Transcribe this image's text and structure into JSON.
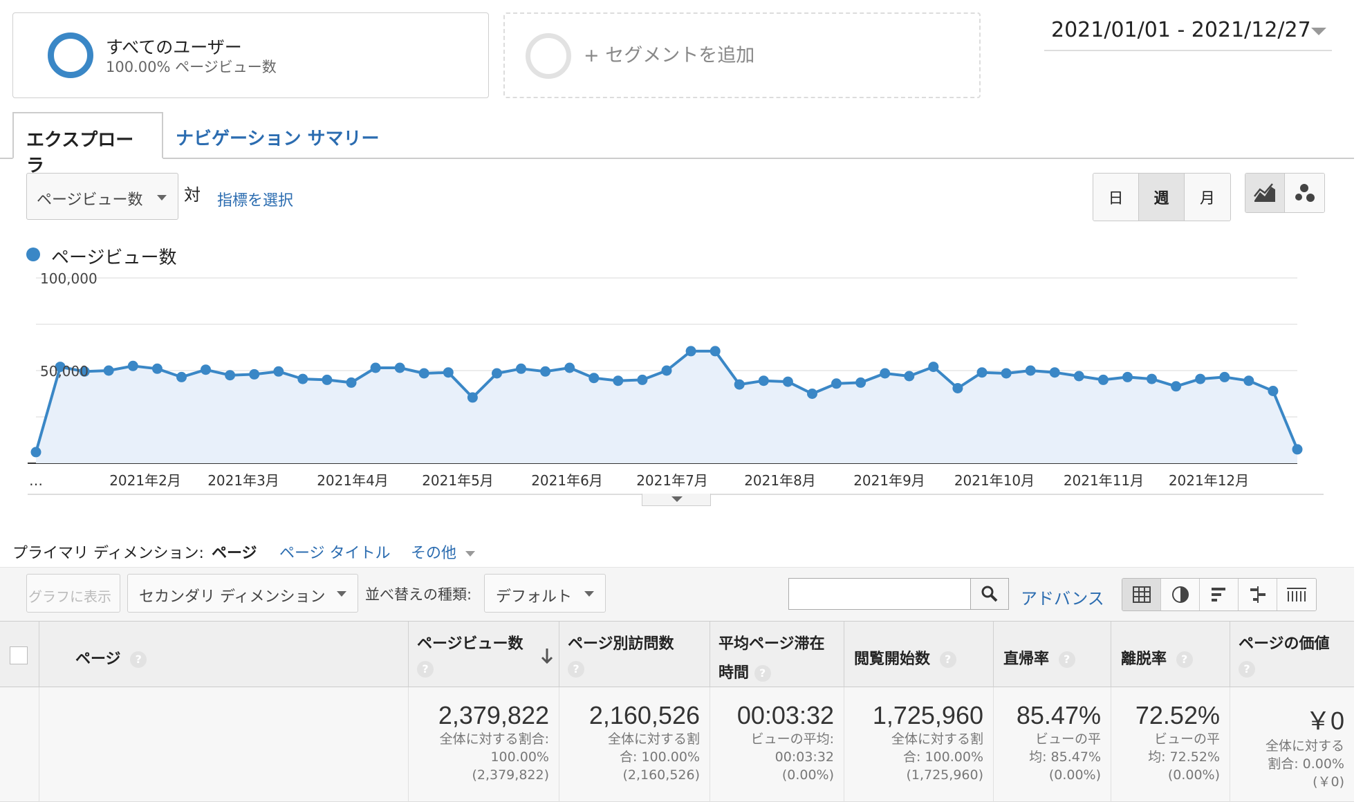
{
  "segments": {
    "active": {
      "name": "すべてのユーザー",
      "sub": "100.00% ページビュー数"
    },
    "add_label": "+ セグメントを追加"
  },
  "date_range": "2021/01/01 - 2021/12/27",
  "tabs": {
    "explorer": "エクスプローラ",
    "nav_summary": "ナビゲーション サマリー"
  },
  "metric": {
    "selected": "ページビュー数",
    "vs": "対",
    "pick": "指標を選択"
  },
  "interval": {
    "day": "日",
    "week": "週",
    "month": "月",
    "selected": "週"
  },
  "chart_icons": [
    "line-chart-icon",
    "motion-chart-icon"
  ],
  "colors": {
    "accent": "#3a87c6",
    "link": "#2b6cb0",
    "fill": "#e8f0fa"
  },
  "chart_data": {
    "type": "line",
    "series": [
      {
        "name": "ページビュー数",
        "values": [
          6000,
          52000,
          49500,
          50000,
          52500,
          51000,
          46500,
          50500,
          47500,
          48000,
          49500,
          45500,
          45000,
          43500,
          51500,
          51500,
          48500,
          49000,
          35500,
          48500,
          51000,
          49500,
          51500,
          46000,
          44500,
          45000,
          50000,
          60500,
          60500,
          42500,
          44500,
          44000,
          37500,
          43000,
          43500,
          48500,
          47000,
          52000,
          40500,
          49000,
          48500,
          50000,
          49000,
          47000,
          45000,
          46500,
          45500,
          41500,
          45500,
          46500,
          44500,
          39000,
          7500
        ]
      }
    ],
    "ylim": [
      0,
      100000
    ],
    "y_ticks": [
      "100,000",
      "50,000"
    ],
    "x_labels": [
      "…",
      "2021年2月",
      "2021年3月",
      "2021年4月",
      "2021年5月",
      "2021年6月",
      "2021年7月",
      "2021年8月",
      "2021年9月",
      "2021年10月",
      "2021年11月",
      "2021年12月"
    ],
    "grid": true,
    "legend": "top-left"
  },
  "dimension": {
    "label": "プライマリ ディメンション:",
    "active": "ページ",
    "links": [
      "ページ タイトル",
      "その他"
    ]
  },
  "toolbar": {
    "plot": "グラフに表示",
    "secondary": "セカンダリ ディメンション",
    "sort_label": "並べ替えの種類:",
    "sort_value": "デフォルト",
    "search_placeholder": "",
    "advance": "アドバンス",
    "view_icons": [
      "table-view-icon",
      "pie-view-icon",
      "performance-view-icon",
      "comparison-view-icon",
      "pivot-view-icon"
    ]
  },
  "table": {
    "headers": {
      "page": "ページ",
      "pageviews": "ページビュー数",
      "unique": "ページ別訪問数",
      "avg_time_1": "平均ページ滞在",
      "avg_time_2": "時間",
      "entrances": "閲覧開始数",
      "bounce": "直帰率",
      "exit": "離脱率",
      "value": "ページの価値"
    },
    "help": "?",
    "totals": {
      "pageviews": {
        "big": "2,379,822",
        "l1": "全体に対する割合:",
        "l2": "100.00%",
        "l3": "(2,379,822)"
      },
      "unique": {
        "big": "2,160,526",
        "l1": "全体に対する割",
        "l2": "合: 100.00%",
        "l3": "(2,160,526)"
      },
      "avg_time": {
        "big": "00:03:32",
        "l1": "ビューの平均:",
        "l2": "00:03:32",
        "l3": "(0.00%)"
      },
      "entrances": {
        "big": "1,725,960",
        "l1": "全体に対する割",
        "l2": "合: 100.00%",
        "l3": "(1,725,960)"
      },
      "bounce": {
        "big": "85.47%",
        "l1": "ビューの平",
        "l2": "均: 85.47%",
        "l3": "(0.00%)"
      },
      "exit": {
        "big": "72.52%",
        "l1": "ビューの平",
        "l2": "均: 72.52%",
        "l3": "(0.00%)"
      },
      "value": {
        "big": "￥0",
        "l1": "全体に対する",
        "l2": "割合: 0.00%",
        "l3": "(￥0)"
      }
    }
  }
}
